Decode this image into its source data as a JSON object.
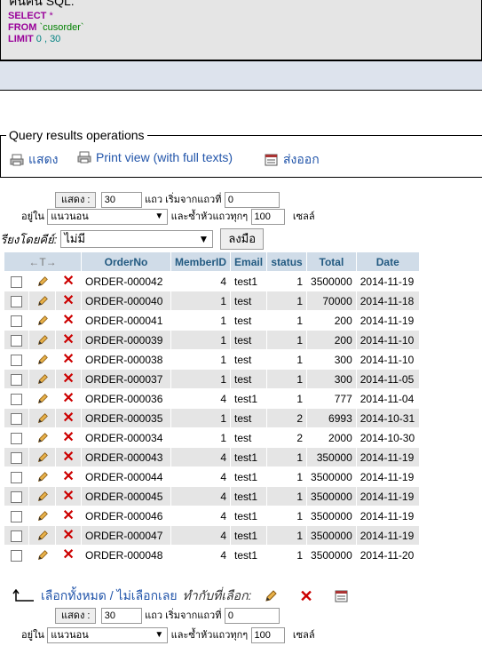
{
  "sql_box": {
    "legend": "ค้นค้น SQL:",
    "lines": [
      {
        "kw": "SELECT",
        "rest": "*"
      },
      {
        "kw": "FROM",
        "rest": "`cusorder`"
      },
      {
        "kw": "LIMIT",
        "rest": "0 , 30"
      }
    ]
  },
  "operations": {
    "legend": "Query results operations",
    "show_label": "แสดง",
    "print_label": "Print view (with full texts)",
    "export_label": "ส่งออก"
  },
  "nav_top": {
    "show_button": "แสดง :",
    "rows_value": "30",
    "rows_from_label": "แถว เริ่มจากแถวที่",
    "start_value": "0",
    "mode_prefix": "อยู่ใน",
    "mode_value": "แนวนอน",
    "repeat_label": "และซ้ำหัวแถวทุกๆ",
    "repeat_value": "100",
    "cells_label": "เซลล์"
  },
  "sort": {
    "label": "เรียงโดยคีย์:",
    "value": "ไม่มี",
    "go_button": "ลงมือ"
  },
  "table": {
    "arrows": "←T→",
    "columns": [
      "OrderNo",
      "MemberID",
      "Email",
      "status",
      "Total",
      "Date"
    ],
    "rows": [
      [
        "ORDER-000042",
        "4",
        "test1",
        "1",
        "3500000",
        "2014-11-19"
      ],
      [
        "ORDER-000040",
        "1",
        "test",
        "1",
        "70000",
        "2014-11-18"
      ],
      [
        "ORDER-000041",
        "1",
        "test",
        "1",
        "200",
        "2014-11-19"
      ],
      [
        "ORDER-000039",
        "1",
        "test",
        "1",
        "200",
        "2014-11-10"
      ],
      [
        "ORDER-000038",
        "1",
        "test",
        "1",
        "300",
        "2014-11-10"
      ],
      [
        "ORDER-000037",
        "1",
        "test",
        "1",
        "300",
        "2014-11-05"
      ],
      [
        "ORDER-000036",
        "4",
        "test1",
        "1",
        "777",
        "2014-11-04"
      ],
      [
        "ORDER-000035",
        "1",
        "test",
        "2",
        "6993",
        "2014-10-31"
      ],
      [
        "ORDER-000034",
        "1",
        "test",
        "2",
        "2000",
        "2014-10-30"
      ],
      [
        "ORDER-000043",
        "4",
        "test1",
        "1",
        "350000",
        "2014-11-19"
      ],
      [
        "ORDER-000044",
        "4",
        "test1",
        "1",
        "3500000",
        "2014-11-19"
      ],
      [
        "ORDER-000045",
        "4",
        "test1",
        "1",
        "3500000",
        "2014-11-19"
      ],
      [
        "ORDER-000046",
        "4",
        "test1",
        "1",
        "3500000",
        "2014-11-19"
      ],
      [
        "ORDER-000047",
        "4",
        "test1",
        "1",
        "3500000",
        "2014-11-19"
      ],
      [
        "ORDER-000048",
        "4",
        "test1",
        "1",
        "3500000",
        "2014-11-20"
      ]
    ]
  },
  "bulk": {
    "select_all": "เลือกทั้งหมด / ไม่เลือกเลย",
    "with_selected": "ทำกับที่เลือก:"
  },
  "nav_bottom": {
    "show_button": "แสดง :",
    "rows_value": "30",
    "rows_from_label": "แถว เริ่มจากแถวที่",
    "start_value": "0",
    "mode_prefix": "อยู่ใน",
    "mode_value": "แนวนอน",
    "repeat_label": "และซ้ำหัวแถวทุกๆ",
    "repeat_value": "100",
    "cells_label": "เซลล์"
  }
}
